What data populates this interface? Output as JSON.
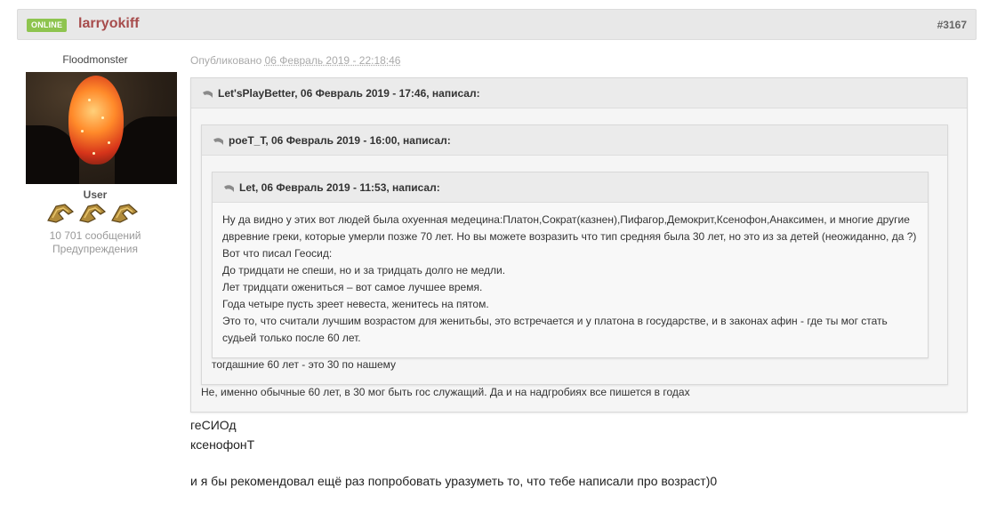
{
  "header": {
    "badge": "ONLINE",
    "author": "larryokiff",
    "post_number": "#3167"
  },
  "user": {
    "title": "Floodmonster",
    "group": "User",
    "post_count": "10 701 сообщений",
    "warnings": "Предупреждения",
    "rank_pips": 3
  },
  "post": {
    "published_label": "Опубликовано",
    "published_date": "06 Февраль 2019 - 22:18:46",
    "quote1": {
      "author_line": "Let'sPlayBetter, 06 Февраль 2019 - 17:46, написал:",
      "tail": "Не, именно обычные 60 лет, в 30 мог быть гос служащий. Да и на надгробиях все пишется в годах"
    },
    "quote2": {
      "author_line": "poeT_T, 06 Февраль 2019 - 16:00, написал:",
      "tail": "тогдашние 60 лет - это 30 по нашему"
    },
    "quote3": {
      "author_line": "Let, 06 Февраль 2019 - 11:53, написал:",
      "lines": [
        "Ну да видно у этих вот людей была охуенная медецина:Платон,Сократ(казнен),Пифагор,Демокрит,Ксенофон,Анаксимен, и многие другие",
        "двревние греки, которые умерли позже 70 лет. Но вы можете возразить что тип средняя была 30 лет, но это из за детей (неожиданно, да ?)",
        "Вот что писал Геосид:",
        "До тридцати не спеши, но и за тридцать долго не медли.",
        "Лет тридцати ожениться – вот самое лучшее время.",
        "Года четыре пусть зреет невеста, женитесь на пятом.",
        "Это то, что считали лучшим возрастом для женитьбы, это встречается и у платона в государстве, и в законах афин - где ты мог стать",
        "судьей только после 60 лет."
      ]
    },
    "body_lines": [
      "геСИОд",
      "ксенофонТ"
    ],
    "body_final": "и я бы рекомендовал ещё раз попробовать уразуметь то, что тебе написали про возраст)0"
  },
  "colors": {
    "badge_green": "#8ec44f",
    "author_red": "#a74c4c"
  }
}
